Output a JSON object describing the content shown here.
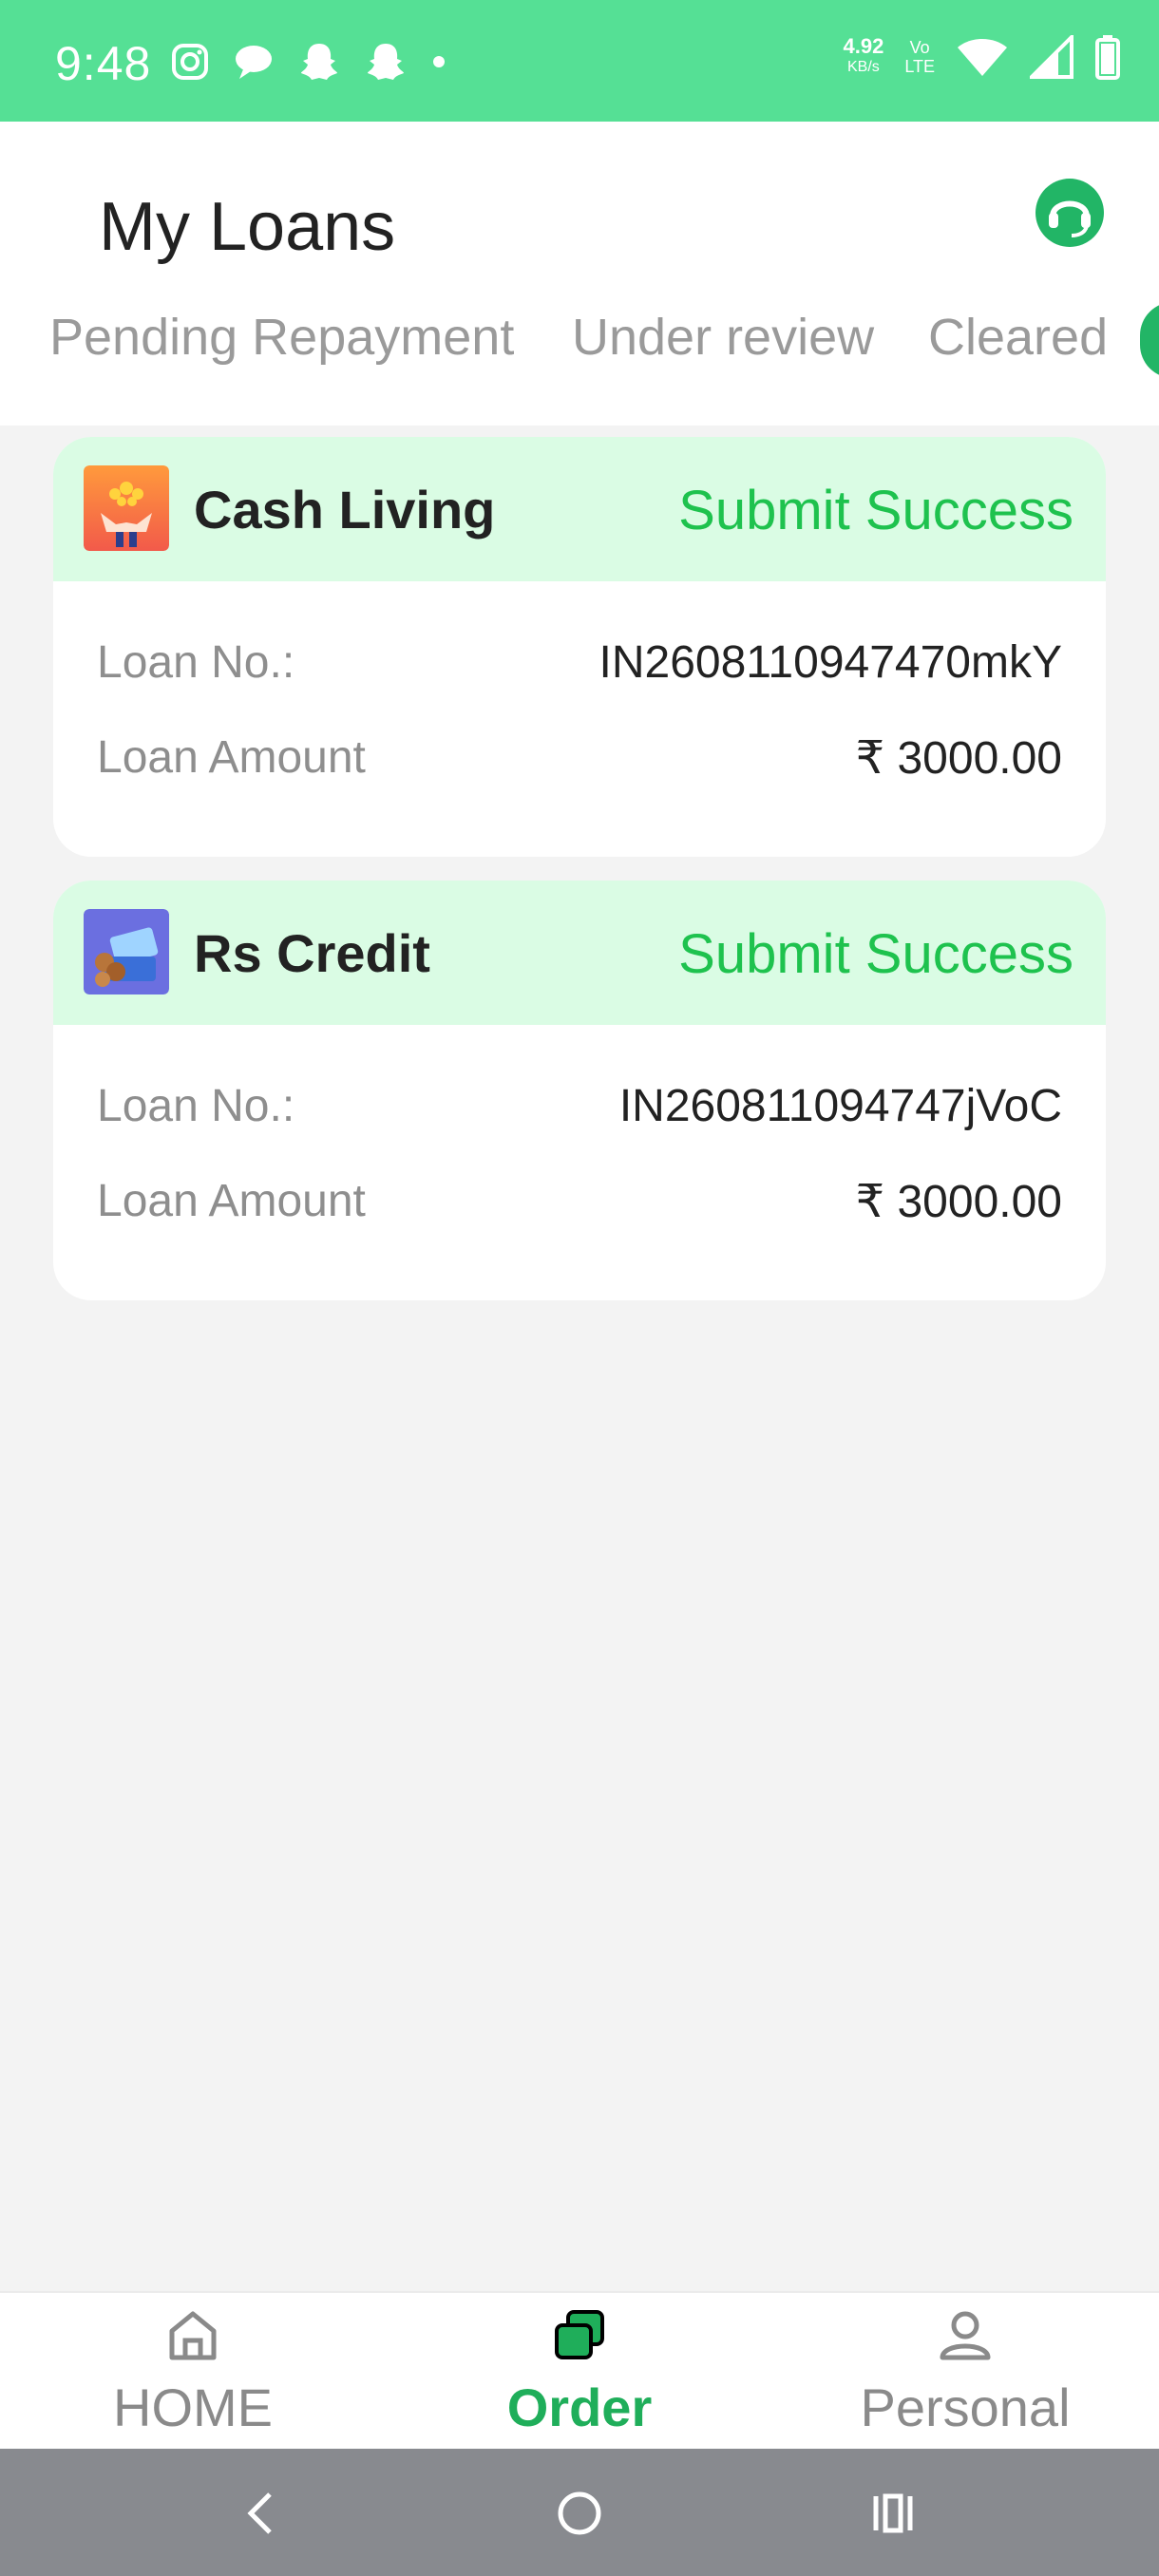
{
  "status_bar": {
    "time": "9:48",
    "net_speed": "4.92",
    "net_unit": "KB/s",
    "volte_top": "Vo",
    "volte_bottom": "LTE"
  },
  "header": {
    "title": "My Loans",
    "tabs": [
      "Pending Repayment",
      "Under review",
      "Cleared"
    ]
  },
  "loans": [
    {
      "name": "Cash Living",
      "status": "Submit Success",
      "loan_no_label": "Loan No.:",
      "loan_no": "IN2608110947470mkY",
      "amount_label": "Loan Amount",
      "amount": "₹ 3000.00"
    },
    {
      "name": "Rs Credit",
      "status": "Submit Success",
      "loan_no_label": "Loan No.:",
      "loan_no": "IN260811094747jVoC",
      "amount_label": "Loan Amount",
      "amount": "₹ 3000.00"
    }
  ],
  "bottom_nav": {
    "items": [
      "HOME",
      "Order",
      "Personal"
    ],
    "active": "Order"
  },
  "colors": {
    "status_bar": "#55e095",
    "accent_green": "#1ec24e",
    "card_header": "#dafce4"
  }
}
